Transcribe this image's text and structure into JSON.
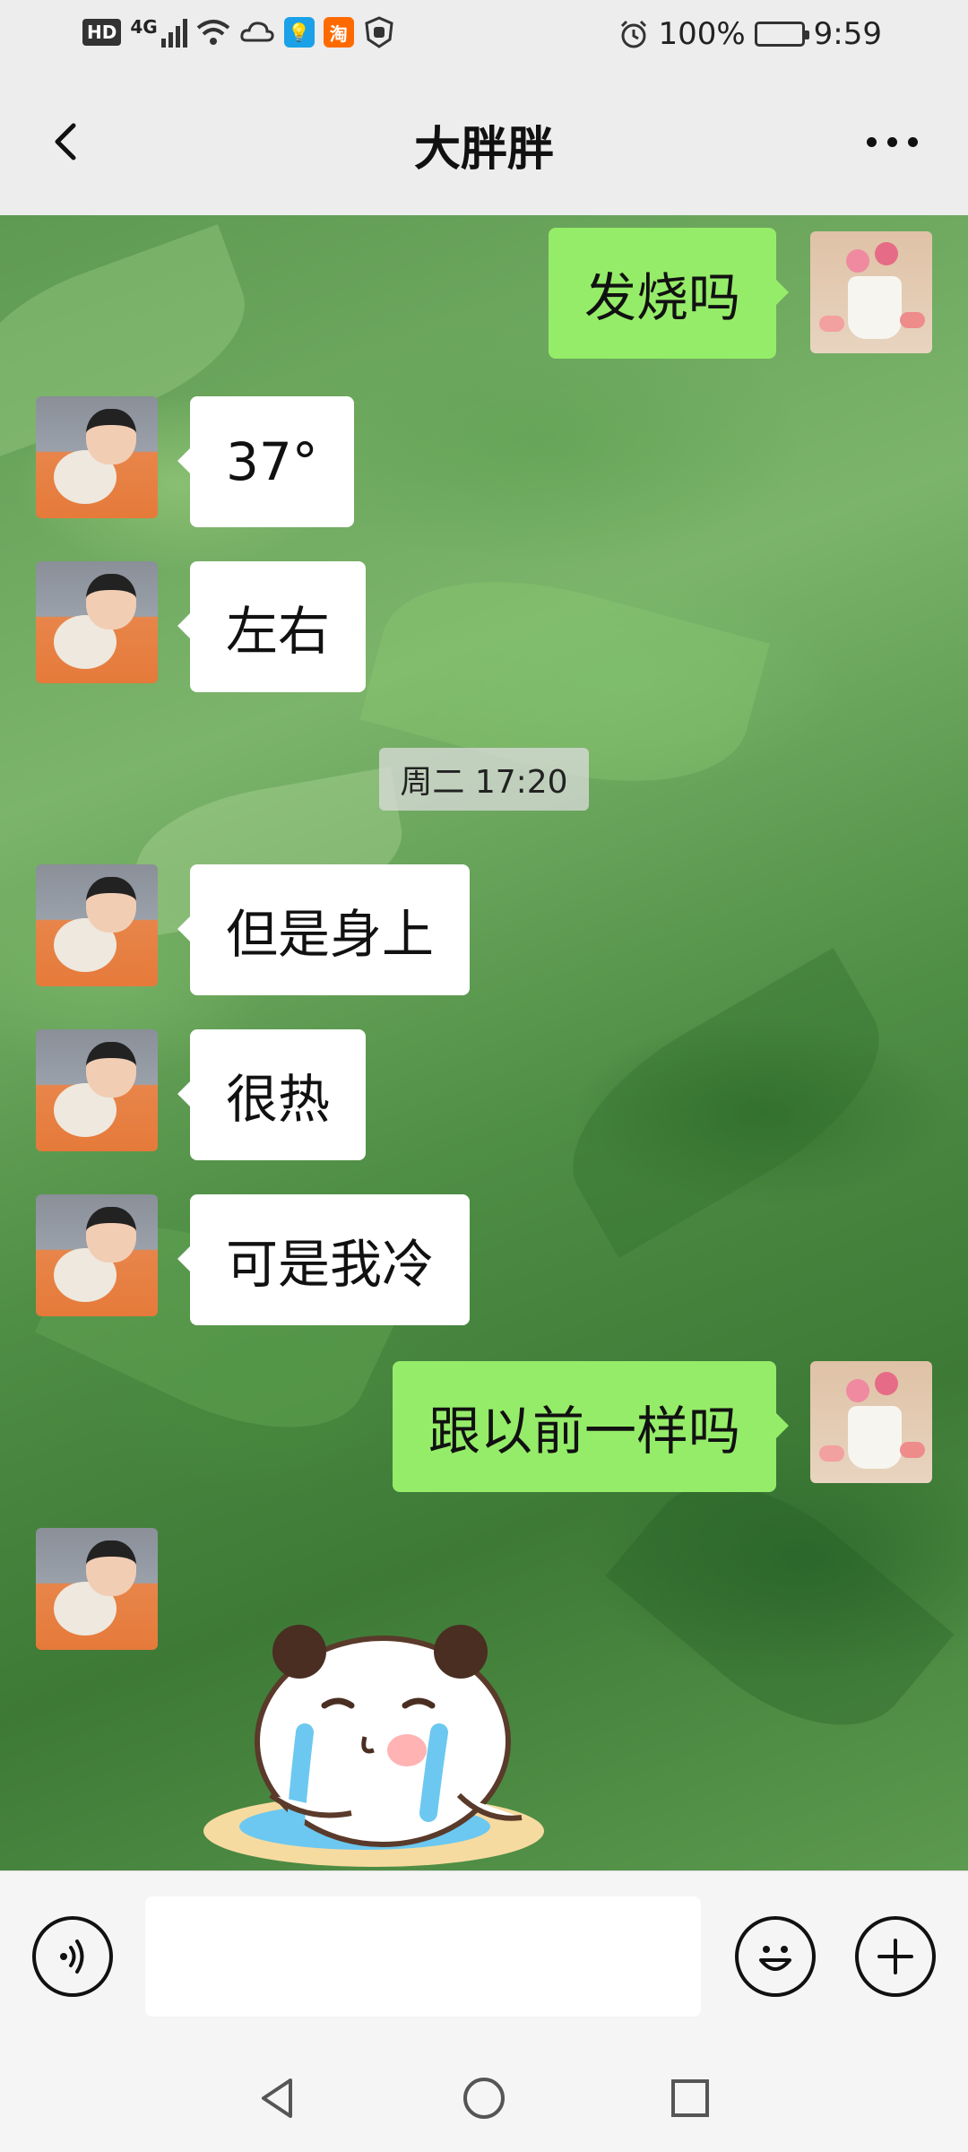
{
  "status_bar": {
    "hd": "HD",
    "network": "4G",
    "taobao": "淘",
    "battery": "100%",
    "time": "9:59"
  },
  "header": {
    "title": "大胖胖",
    "back_icon": "chevron-left-icon",
    "more_icon": "more-dots-icon"
  },
  "messages": [
    {
      "side": "out",
      "text": "发烧吗"
    },
    {
      "side": "in",
      "text": "37°"
    },
    {
      "side": "in",
      "text": "左右"
    },
    {
      "side": "in",
      "text": "但是身上"
    },
    {
      "side": "in",
      "text": "很热"
    },
    {
      "side": "in",
      "text": "可是我冷"
    },
    {
      "side": "out",
      "text": "跟以前一样吗"
    },
    {
      "side": "in",
      "type": "sticker",
      "sticker": "crying-panda-sticker"
    }
  ],
  "timestamp": "周二 17:20",
  "input_bar": {
    "voice_icon": "voice-icon",
    "emoji_icon": "smiley-icon",
    "plus_icon": "plus-icon",
    "value": ""
  },
  "nav_bar": {
    "back_icon": "triangle-back-icon",
    "home_icon": "circle-home-icon",
    "recents_icon": "square-recents-icon"
  }
}
